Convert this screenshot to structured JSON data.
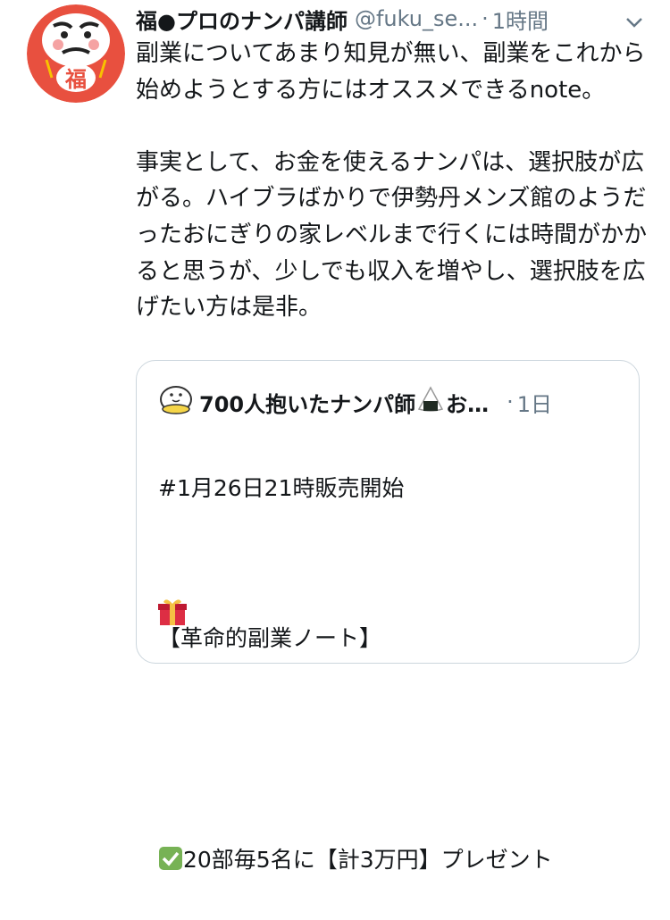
{
  "tweet": {
    "author_name": "福●プロのナンパ講師",
    "handle": "@fuku_se...",
    "time": "1時間",
    "separator": "·",
    "avatar_text": "福",
    "text": "副業についてあまり知見が無い、副業をこれから始めようとする方にはオススメできるnote。\n\n事実として、お金を使えるナンパは、選択肢が広がる。ハイブラばかりで伊勢丹メンズ館のようだったおにぎりの家レベルまで行くには時間がかかると思うが、少しでも収入を増やし、選択肢を広げたい方は是非。"
  },
  "quoted": {
    "author_name": "700人抱いたナンパ師",
    "ellipsis": "お…",
    "time": "1日",
    "separator": "·",
    "line1": "#1月26日21時販売開始",
    "line2": "【革命的副業ノート】",
    "line3": "20部毎5名に【計3万円】プレゼント"
  },
  "icons": {
    "caret": "chevron-down-icon",
    "check": "check-mark-icon",
    "gift": "gift-icon",
    "onigiri": "onigiri-icon",
    "character": "character-icon"
  },
  "colors": {
    "text": "#14171a",
    "secondary": "#657786",
    "border": "#ccd6dd",
    "daruma_red": "#e8503f",
    "check_green": "#77b255",
    "gift_red": "#dd2e44"
  }
}
